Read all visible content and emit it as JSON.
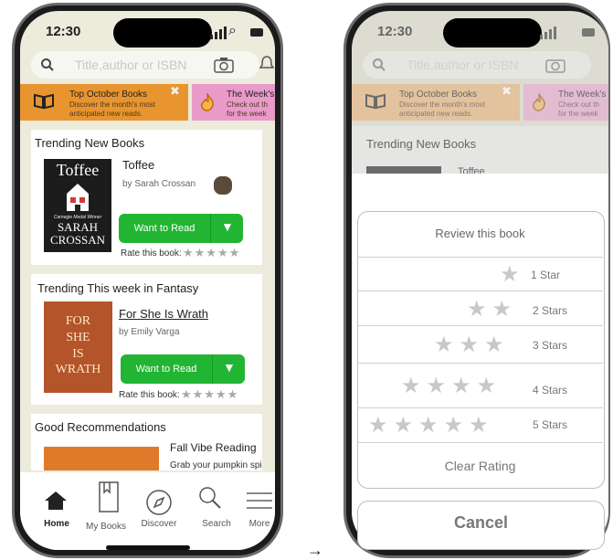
{
  "arrow": "→",
  "left": {
    "status": {
      "time": "12:30"
    },
    "search": {
      "placeholder": "Title,author or ISBN"
    },
    "banners": [
      {
        "title": "Top October Books",
        "subtitle1": "Discover the month's most",
        "subtitle2": "anticipated new reads."
      },
      {
        "title": "The Week's",
        "subtitle1": "Check out th",
        "subtitle2": "for the week"
      }
    ],
    "trending_new": {
      "heading": "Trending New Books",
      "book_title": "Toffee",
      "author": "by Sarah Crossan",
      "cover_title": "Toffee",
      "cover_award": "Carnegie Medal Winner",
      "cover_author1": "SARAH",
      "cover_author2": "CROSSAN",
      "want_to_read": "Want to Read",
      "rate_label": "Rate this book:"
    },
    "trending_fantasy": {
      "heading": "Trending This week in Fantasy",
      "book_title": "For She Is Wrath",
      "author": "by Emily Varga",
      "cover_l1": "FOR",
      "cover_l2": "SHE",
      "cover_l3": "IS",
      "cover_l4": "WRATH",
      "want_to_read": "Want to Read",
      "rate_label": "Rate this book:"
    },
    "recommendations": {
      "heading": "Good Recommendations",
      "item_title": "Fall Vibe Reading",
      "item_sub": "Grab your pumpkin spic"
    },
    "tabbar": {
      "home": "Home",
      "mybooks": "My Books",
      "discover": "Discover",
      "search": "Search",
      "more": "More"
    }
  },
  "right": {
    "status": {
      "time": "12:30"
    },
    "search": {
      "placeholder": "Title,author or ISBN"
    },
    "banners": [
      {
        "title": "Top October Books",
        "subtitle1": "Discover the month's most",
        "subtitle2": "anticipated new reads."
      },
      {
        "title": "The Week's",
        "subtitle1": "Check out th",
        "subtitle2": "for the week"
      }
    ],
    "section_heading": "Trending New Books",
    "peek_title": "Toffee",
    "sheet": {
      "title": "Review this book",
      "options": [
        "1 Star",
        "2 Stars",
        "3 Stars",
        "4 Stars",
        "5 Stars"
      ],
      "star_counts": [
        1,
        2,
        3,
        4,
        5
      ],
      "clear": "Clear Rating",
      "cancel": "Cancel"
    }
  },
  "colors": {
    "app_bg": "#ecebdc",
    "banner_orange": "#e8952f",
    "banner_pink": "#e99ac9",
    "green": "#22b533"
  }
}
